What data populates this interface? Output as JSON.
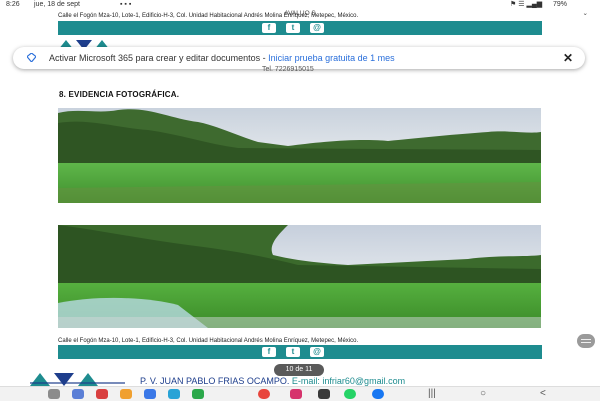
{
  "status": {
    "time": "8:26",
    "date": "jue, 18 de sept",
    "battery": "79%"
  },
  "document": {
    "title": "AVALUO S"
  },
  "footer": {
    "address": "Calle el Fogón Mza-10, Lote-1, Edificio-H-3, Col. Unidad Habitacional Andrés Molina Enríquez, Metepec, México."
  },
  "banner": {
    "message": "Activar Microsoft 365 para crear y editar documentos - ",
    "link": "Iniciar prueba gratuita de 1 mes",
    "close": "✕"
  },
  "header": {
    "tel": "Tel. 7226915015"
  },
  "section": {
    "title": "8. EVIDENCIA FOTOGRÁFICA."
  },
  "pagination": {
    "indicator": "10 de 11"
  },
  "next_page": {
    "text_a": "P. V. JUAN PABLO FRIAS OCAMPO.",
    "text_b": "E-mail: infriar60@gmail.com"
  },
  "colors": {
    "accent": "#1e8c8f",
    "brand_blue": "#1e3e8c",
    "link": "#2a6fdb"
  },
  "social_icons": [
    "facebook-icon",
    "twitter-icon",
    "email-icon"
  ],
  "nav": {
    "recent": "|||",
    "home": "○",
    "back": "<"
  }
}
